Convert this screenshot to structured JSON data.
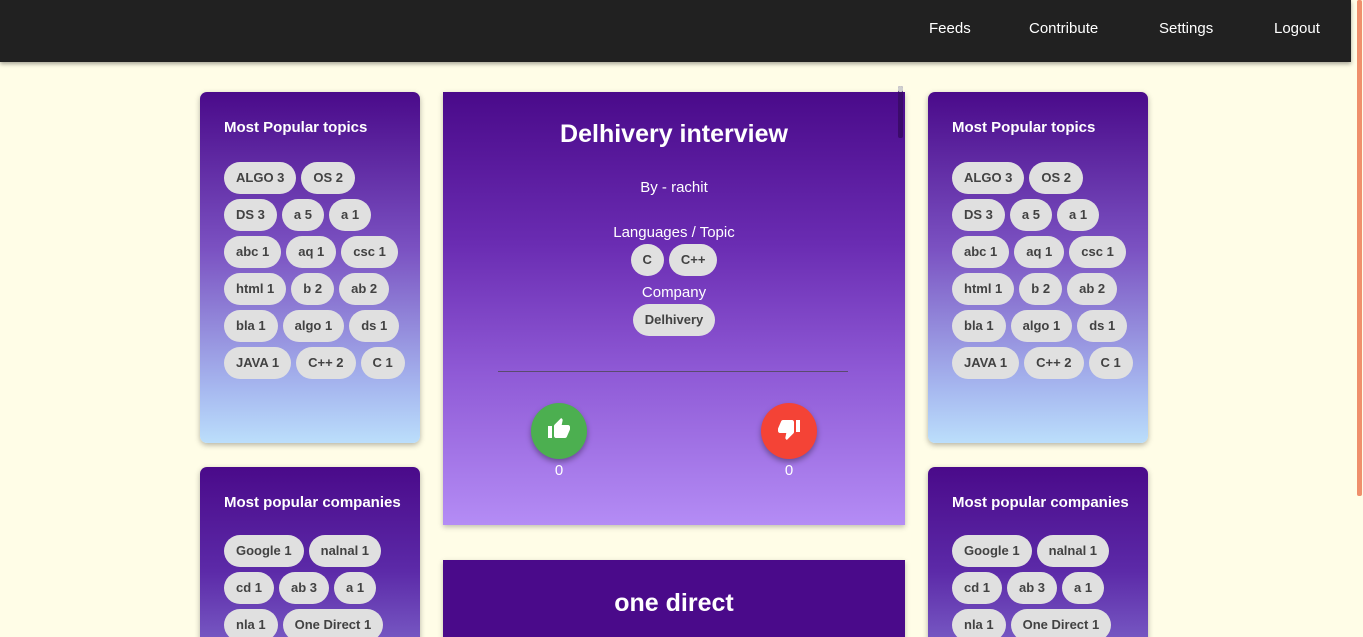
{
  "nav": {
    "items": [
      {
        "label": "Feeds"
      },
      {
        "label": "Contribute"
      },
      {
        "label": "Settings"
      },
      {
        "label": "Logout"
      }
    ]
  },
  "left": {
    "topics": {
      "title": "Most Popular topics",
      "chips": [
        "ALGO 3",
        "OS 2",
        "DS 3",
        "a 5",
        "a 1",
        "abc 1",
        "aq 1",
        "csc 1",
        "html 1",
        "b 2",
        "ab 2",
        "bla 1",
        "algo 1",
        "ds 1",
        "JAVA 1",
        "C++ 2",
        "C 1"
      ]
    },
    "companies": {
      "title": "Most popular companies",
      "chips": [
        "Google 1",
        "nalnal 1",
        "cd 1",
        "ab 3",
        "a 1",
        "nla 1",
        "One Direct 1"
      ]
    }
  },
  "right": {
    "topics": {
      "title": "Most Popular topics",
      "chips": [
        "ALGO 3",
        "OS 2",
        "DS 3",
        "a 5",
        "a 1",
        "abc 1",
        "aq 1",
        "csc 1",
        "html 1",
        "b 2",
        "ab 2",
        "bla 1",
        "algo 1",
        "ds 1",
        "JAVA 1",
        "C++ 2",
        "C 1"
      ]
    },
    "companies": {
      "title": "Most popular companies",
      "chips": [
        "Google 1",
        "nalnal 1",
        "cd 1",
        "ab 3",
        "a 1",
        "nla 1",
        "One Direct 1"
      ]
    }
  },
  "posts": [
    {
      "title": "Delhivery interview",
      "author": "By - rachit",
      "languages_label": "Languages / Topic",
      "languages": [
        "C",
        "C++"
      ],
      "company_label": "Company",
      "companies": [
        "Delhivery"
      ],
      "upvotes": "0",
      "downvotes": "0"
    },
    {
      "title": "one direct"
    }
  ],
  "icons": {
    "upvote": "thumbs-up-icon",
    "downvote": "thumbs-down-icon"
  },
  "colors": {
    "navbar": "#212121",
    "background": "#fffde7",
    "card_top": "#4a0a8a",
    "chip": "#e0e0e0",
    "upvote": "#4caf50",
    "downvote": "#f44336"
  }
}
